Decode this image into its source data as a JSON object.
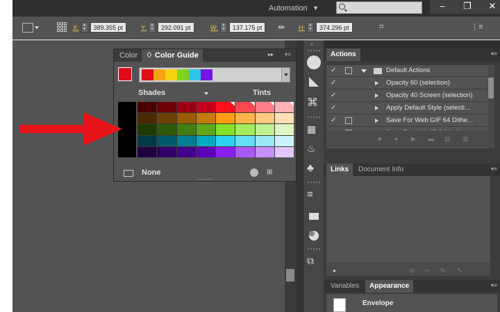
{
  "topbar": {
    "workspace_label": "Automation",
    "workspace_arrow": "▾",
    "window_buttons": [
      "–",
      "❐",
      "✕"
    ]
  },
  "controlbar": {
    "x_label": "X:",
    "x_value": "389.355 pt",
    "y_label": "Y:",
    "y_value": "292.091 pt",
    "w_label": "W:",
    "w_value": "137.175 pt",
    "h_label": "H:",
    "h_value": "374.296 pt"
  },
  "color_panel": {
    "tabs": [
      {
        "label": "Color",
        "active": false
      },
      {
        "label": "♢ Color Guide",
        "active": true
      }
    ],
    "panel_controls": "▸▸",
    "current_color": "#e00c1a",
    "harmony_colors": [
      "#e00c1a",
      "#f7a313",
      "#f5d411",
      "#7ed321",
      "#2ec4e8",
      "#7316e6"
    ],
    "shades_label": "Shades",
    "tints_label": "Tints",
    "variation_rows": [
      [
        "#4a0000",
        "#6e0008",
        "#9a0010",
        "#c8001a",
        "#ff0d1a",
        "#ff4a55",
        "#ff7f88",
        "#ffb1b7"
      ],
      [
        "#4a2a00",
        "#6e4200",
        "#9a5c00",
        "#c77a00",
        "#ff9d12",
        "#ffb34a",
        "#ffc97f",
        "#ffe0b5"
      ],
      [
        "#1e3a00",
        "#2e5a08",
        "#437f10",
        "#5ea818",
        "#85e026",
        "#a3ea5c",
        "#c0f08f",
        "#dff7c3"
      ],
      [
        "#003a44",
        "#005a68",
        "#007f92",
        "#00a8c0",
        "#2ed2f0",
        "#67def5",
        "#9be8f8",
        "#cdf4fc"
      ],
      [
        "#1e003f",
        "#300064",
        "#45008c",
        "#5c00b8",
        "#8a1ef0",
        "#a95af4",
        "#c690f8",
        "#e2c6fb"
      ]
    ],
    "foot_label": "None"
  },
  "actions_panel": {
    "tab": "Actions",
    "rows": [
      {
        "label": "Default Actions",
        "set": true
      },
      {
        "label": "Opacity 60 (selection)",
        "set": false
      },
      {
        "label": "Opacity 40 Screen (selection)",
        "set": false
      },
      {
        "label": "Apply Default Style (selecti...",
        "set": false
      },
      {
        "label": "Save For Web GIF 64 Dithe...",
        "set": false
      },
      {
        "label": "Save For Web JPG Medium",
        "set": false
      }
    ]
  },
  "links_panel": {
    "tabs": [
      {
        "label": "Links",
        "active": true
      },
      {
        "label": "Document Info",
        "active": false
      }
    ]
  },
  "appearance_panel": {
    "tabs": [
      {
        "label": "Variables",
        "active": false
      },
      {
        "label": "Appearance",
        "active": true
      }
    ],
    "item_label": "Envelope"
  },
  "annotation": {
    "arrow_color": "#e8141b"
  }
}
